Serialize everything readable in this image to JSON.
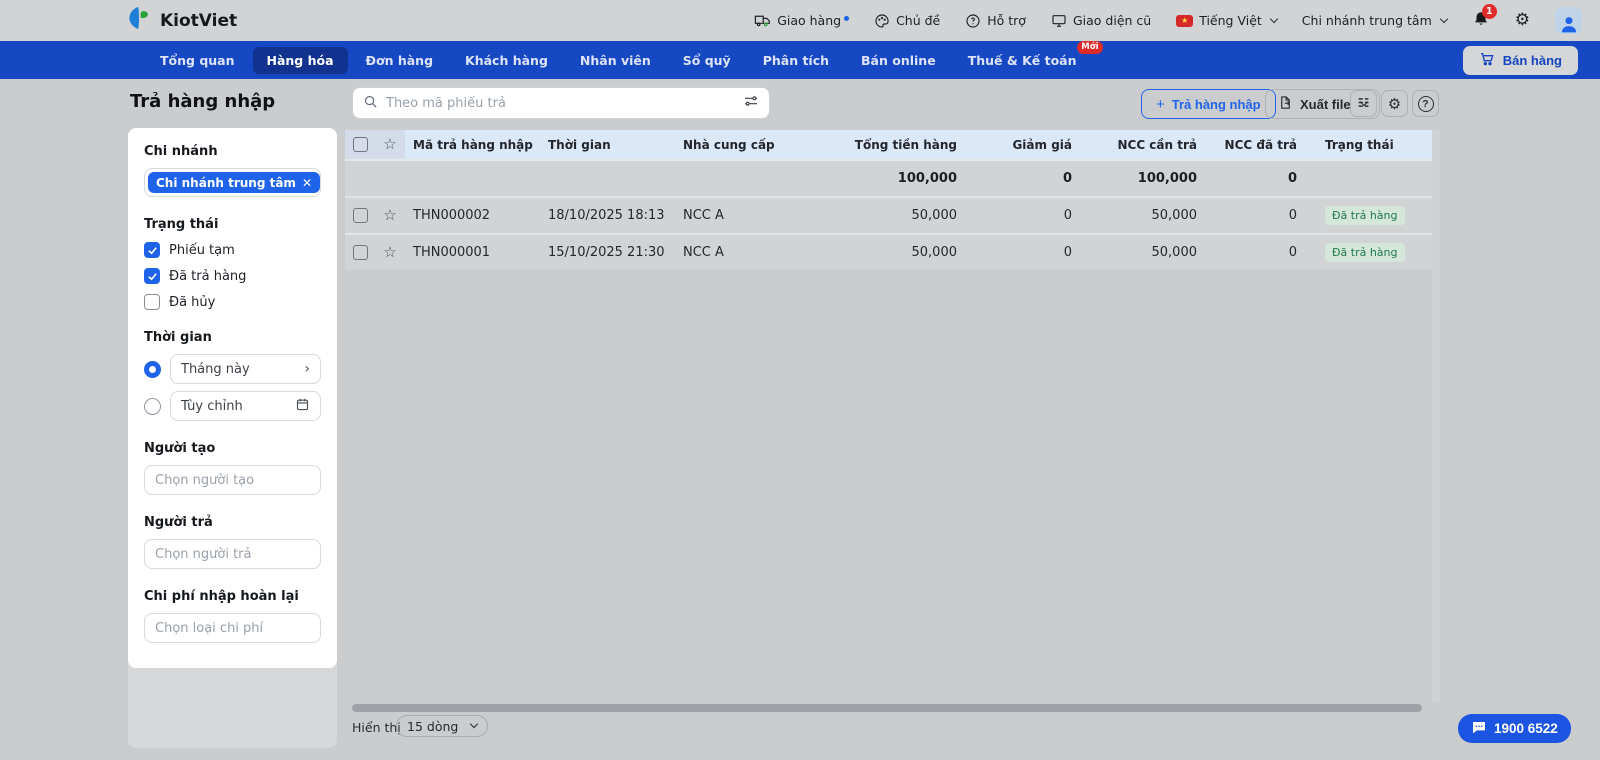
{
  "colors": {
    "nav_blue": "#1648c4",
    "nav_active": "#11338f",
    "accent_blue": "#1e63e9",
    "status_green_bg": "#d5e6da",
    "status_green_text": "#21784a",
    "badge_red": "#e02b2b",
    "table_header_bg": "#dbe8f8"
  },
  "topbar": {
    "brand": "KiotViet",
    "delivery": "Giao hàng",
    "theme": "Chủ đề",
    "support": "Hỗ trợ",
    "old_ui": "Giao diện cũ",
    "language": "Tiếng Việt",
    "branch": "Chi nhánh trung tâm",
    "notification_count": "1"
  },
  "nav": {
    "items": [
      {
        "label": "Tổng quan"
      },
      {
        "label": "Hàng hóa"
      },
      {
        "label": "Đơn hàng"
      },
      {
        "label": "Khách hàng"
      },
      {
        "label": "Nhân viên"
      },
      {
        "label": "Sổ quỹ"
      },
      {
        "label": "Phân tích"
      },
      {
        "label": "Bán online"
      },
      {
        "label": "Thuế & Kế toán",
        "badge": "Mới"
      }
    ],
    "sell_button": "Bán hàng"
  },
  "sidebar": {
    "title": "Trả hàng nhập",
    "branch": {
      "label": "Chi nhánh",
      "chip": "Chi nhánh trung tâm"
    },
    "status": {
      "label": "Trạng thái",
      "options": [
        {
          "label": "Phiếu tạm",
          "checked": true
        },
        {
          "label": "Đã trả hàng",
          "checked": true
        },
        {
          "label": "Đã hủy",
          "checked": false
        }
      ]
    },
    "time": {
      "label": "Thời gian",
      "preset": "Tháng này",
      "custom": "Tùy chỉnh"
    },
    "creator": {
      "label": "Người tạo",
      "placeholder": "Chọn người tạo"
    },
    "returner": {
      "label": "Người trả",
      "placeholder": "Chọn người trả"
    },
    "cost": {
      "label": "Chi phí nhập hoàn lại",
      "placeholder": "Chọn loại chi phí"
    }
  },
  "toolbar": {
    "search_placeholder": "Theo mã phiếu trả",
    "new_button": "Trả hàng nhập",
    "export_button": "Xuất file"
  },
  "table": {
    "columns": {
      "code": "Mã trả hàng nhập",
      "time": "Thời gian",
      "supplier": "Nhà cung cấp",
      "total": "Tổng tiền hàng",
      "discount": "Giảm giá",
      "ncc_due": "NCC cần trả",
      "ncc_paid": "NCC đã trả",
      "status": "Trạng thái"
    },
    "summary": {
      "total": "100,000",
      "discount": "0",
      "ncc_due": "100,000",
      "ncc_paid": "0"
    },
    "rows": [
      {
        "code": "THN000002",
        "time": "18/10/2025 18:13",
        "supplier": "NCC A",
        "total": "50,000",
        "discount": "0",
        "ncc_due": "50,000",
        "ncc_paid": "0",
        "status": "Đã trả hàng"
      },
      {
        "code": "THN000001",
        "time": "15/10/2025 21:30",
        "supplier": "NCC A",
        "total": "50,000",
        "discount": "0",
        "ncc_due": "50,000",
        "ncc_paid": "0",
        "status": "Đã trả hàng"
      }
    ]
  },
  "footer": {
    "display_label": "Hiển thị",
    "page_size": "15 dòng",
    "hotline": "1900 6522"
  }
}
